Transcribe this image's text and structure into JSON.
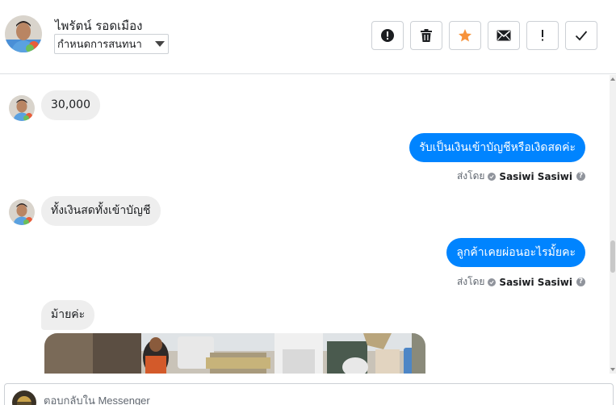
{
  "header": {
    "contact_name": "ไพรัตน์ รอดเมือง",
    "label_select": "กำหนดการสนทนา",
    "toolbar": [
      {
        "icon": "alert-circle-icon",
        "name": "spam-button"
      },
      {
        "icon": "trash-icon",
        "name": "delete-button"
      },
      {
        "icon": "star-icon",
        "name": "star-button"
      },
      {
        "icon": "envelope-icon",
        "name": "mark-unread-button"
      },
      {
        "icon": "exclamation-icon",
        "name": "follow-up-button"
      },
      {
        "icon": "checkmark-icon",
        "name": "mark-done-button"
      }
    ]
  },
  "colors": {
    "outgoing_bubble": "#0084ff",
    "incoming_bubble": "#eeeeee",
    "star_accent": "#f7923b"
  },
  "messages": [
    {
      "direction": "in",
      "text": "30,000"
    },
    {
      "direction": "out",
      "text": "รับเป็นเงินเข้าบัญชีหรือเงิดสดค่ะ",
      "sent_by_label": "ส่งโดย",
      "agent": "Sasiwi Sasiwi"
    },
    {
      "direction": "in",
      "text": "ทั้งเงินสดทั้งเข้าบัญชี"
    },
    {
      "direction": "out",
      "text": "ลูกค้าเคยผ่อนอะไรมั้ยคะ",
      "sent_by_label": "ส่งโดย",
      "agent": "Sasiwi Sasiwi"
    },
    {
      "direction": "in",
      "text": "ม้ายค่ะ"
    }
  ],
  "reply": {
    "placeholder": "ตอบกลับใน Messenger"
  }
}
